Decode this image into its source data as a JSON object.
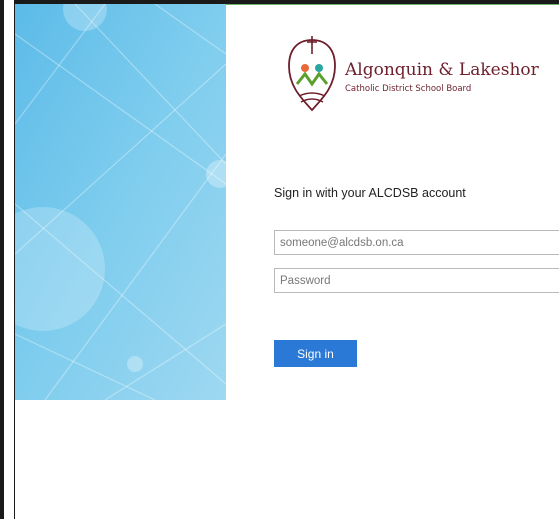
{
  "brand": {
    "name": "Algonquin & Lakeshor",
    "subtitle": "Catholic District School Board",
    "primary_color": "#6d1f2c"
  },
  "signin": {
    "heading": "Sign in with your ALCDSB account",
    "email_placeholder": "someone@alcdsb.on.ca",
    "password_placeholder": "Password",
    "button_label": "Sign in",
    "button_color": "#2b79d7"
  },
  "background": {
    "color": "#6ec4ea"
  }
}
